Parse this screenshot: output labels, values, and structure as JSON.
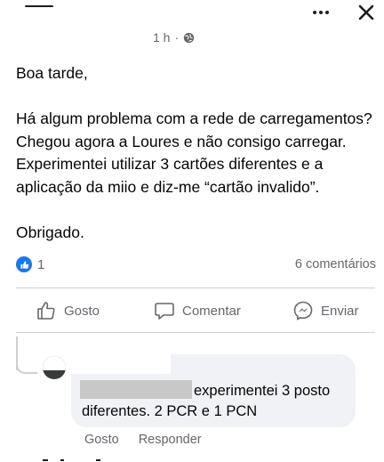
{
  "header": {
    "time": "1 h",
    "separator": "·",
    "more_icon": "more-horizontal-icon",
    "close_icon": "close-icon",
    "privacy_icon": "globe-icon"
  },
  "post": {
    "greeting": "Boa tarde,",
    "body": "Há algum problema com a rede de carregamentos? Chegou agora a Loures e não consigo carregar. Experimentei utilizar 3 cartões diferentes e a aplicação da miio e diz-me “cartão invalido”.",
    "closing": "Obrigado."
  },
  "reactions": {
    "like_count": "1",
    "comments_label": "6 comentários"
  },
  "actions": {
    "like": "Gosto",
    "comment": "Comentar",
    "share": "Enviar"
  },
  "comment": {
    "text": "experimentei 3 posto diferentes. 2 PCR e 1 PCN",
    "like": "Gosto",
    "reply": "Responder"
  },
  "colors": {
    "accent": "#1877f2",
    "muted_text": "#65676b",
    "bubble": "#f0f2f5"
  }
}
